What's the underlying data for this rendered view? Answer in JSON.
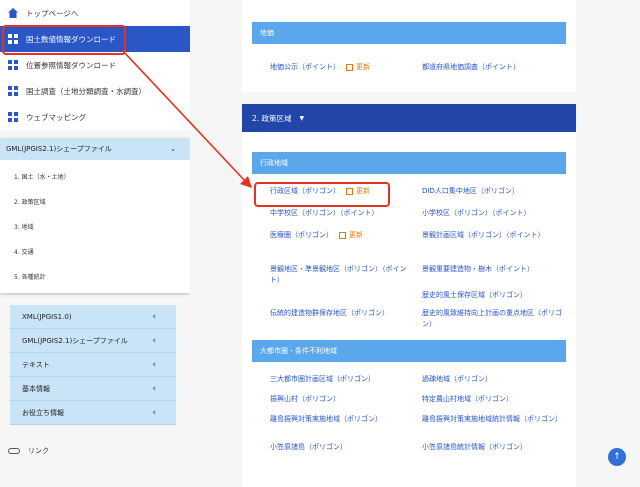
{
  "sidebar": {
    "nav": [
      {
        "label": "トップページへ",
        "icon": "home-icon"
      },
      {
        "label": "国土数値情報ダウンロード",
        "icon": "grid-icon",
        "active": true
      },
      {
        "label": "位置参照情報ダウンロード",
        "icon": "grid-icon"
      },
      {
        "label": "国土調査（土地分類調査・水調査）",
        "icon": "grid-icon"
      },
      {
        "label": "ウェブマッピング",
        "icon": "grid-icon"
      }
    ],
    "gml_panel": {
      "title": "GML(JPGIS2.1)シェープファイル",
      "items": [
        "1. 国土（水・土地）",
        "2. 政策区域",
        "3. 地域",
        "4. 交通",
        "5. 各種統計"
      ]
    },
    "accordion": [
      "XML(JPGIS1.0)",
      "GML(JPGIS2.1)シェープファイル",
      "テキスト",
      "基本情報",
      "お役立ち情報"
    ],
    "link_label": "リンク"
  },
  "main": {
    "chika": {
      "title": "地価",
      "links": [
        {
          "label": "地価公示（ポイント）",
          "update": "更新"
        },
        {
          "label": "都道府県地価調査（ポイント）"
        }
      ]
    },
    "section2": {
      "title": "2. 政策区域",
      "groups": [
        {
          "title": "行政地域",
          "links": [
            {
              "label": "行政区域（ポリゴン）",
              "update": "更新"
            },
            {
              "label": "DID人口集中地区（ポリゴン）"
            },
            {
              "label": "中学校区（ポリゴン）（ポイント）"
            },
            {
              "label": "小学校区（ポリゴン）（ポイント）"
            },
            {
              "label": "医療圏（ポリゴン）",
              "update": "更新"
            },
            {
              "label": "景観計画区域（ポリゴン）（ポイント）"
            },
            {
              "label": "景観地区・準景観地区（ポリゴン）（ポイント）"
            },
            {
              "label": "景観重要建造物・樹木（ポイント）"
            },
            {
              "label": ""
            },
            {
              "label": "歴史的風土保存区域（ポリゴン）"
            },
            {
              "label": "伝統的建造物群保存地区（ポリゴン）"
            },
            {
              "label": "歴史的風致維持向上計画の重点地区（ポリゴン）"
            }
          ]
        },
        {
          "title": "大都市圏・条件不利地域",
          "links": [
            {
              "label": "三大都市圏計画区域（ポリゴン）"
            },
            {
              "label": "過疎地域（ポリゴン）"
            },
            {
              "label": "振興山村（ポリゴン）"
            },
            {
              "label": "特定農山村地域（ポリゴン）"
            },
            {
              "label": "離島振興対策実施地域（ポリゴン）"
            },
            {
              "label": "離島振興対策実施地域統計情報（ポリゴン）"
            },
            {
              "label": "小笠原諸島（ポリゴン）"
            },
            {
              "label": "小笠原諸島統計情報（ポリゴン）"
            }
          ]
        }
      ]
    },
    "scroll_top_icon": "arrow-up-icon"
  },
  "colors": {
    "accent": "#2a56c6",
    "section_bar": "#5aa7ec",
    "panel_head": "#2145a8",
    "highlight": "#e53222",
    "update": "#e07b12"
  }
}
